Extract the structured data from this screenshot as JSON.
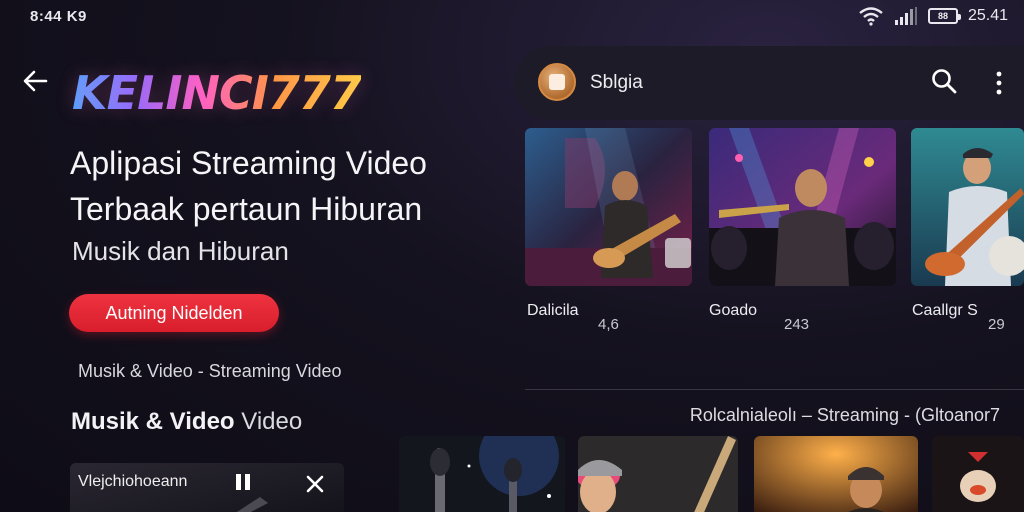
{
  "status_bar": {
    "left_text": "8:44 K9",
    "clock": "25.41",
    "battery_label": "88"
  },
  "header": {
    "brand": "KELINCI777"
  },
  "hero": {
    "title_line1": "Aplipasi Streaming Video",
    "title_line2": "Terbaak pertaun Hiburan",
    "subtitle": "Musik dan Hiburan",
    "cta_label": "Autning Nidelden",
    "caption": "Musik & Video - Streaming Video",
    "section_title_bold": "Musik & Video",
    "section_title_light": "Video"
  },
  "mini_player": {
    "label": "Vlejchiohoeann"
  },
  "search": {
    "label": "Sblgia"
  },
  "cards": [
    {
      "title": "Dalicila",
      "count": "4,6"
    },
    {
      "title": "Goado",
      "count": "243"
    },
    {
      "title": "Caallgr S",
      "count": "29"
    }
  ],
  "row_caption": "Rolcalnialeolı – Streaming - (Gltoanor7",
  "icons": {
    "back": "arrow-left-icon",
    "search": "search-icon",
    "more": "more-vertical-icon",
    "wifi": "wifi-icon",
    "signal": "signal-icon",
    "battery": "battery-icon",
    "pause": "pause-icon",
    "close": "close-icon"
  },
  "colors": {
    "background": "#15121f",
    "cta": "#e2232f",
    "surface": "#1e1b28"
  }
}
